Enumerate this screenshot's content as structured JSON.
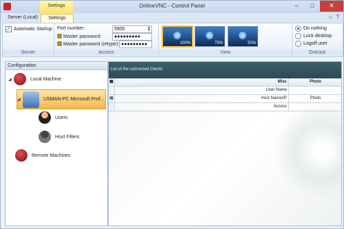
{
  "window": {
    "title": "OnlineVNC - Control Panel",
    "context_tab": "Settings"
  },
  "ribbon_tabs": [
    "Server (Local)",
    "Settings"
  ],
  "server_group": {
    "title": "Server",
    "automatic_startup_label": "Automatic Startup",
    "automatic_startup_checked": true
  },
  "access_group": {
    "title": "Access",
    "port_label": "Port number:",
    "port_value": "5900",
    "master_password_label": "Master password:",
    "master_password_value": "●●●●●●●●●",
    "master_password_retype_label": "Master password (retype):",
    "master_password_retype_value": "●●●●●●●●●"
  },
  "view_group": {
    "title": "View",
    "thumbnails": [
      "100%",
      "75%",
      "50%"
    ],
    "selected": "100%"
  },
  "outcast_group": {
    "title": "Outcast",
    "options": [
      "Do nothing",
      "Lock desktop",
      "Logoff user"
    ],
    "selected": "Do nothing"
  },
  "configuration": {
    "title": "Configuration",
    "local_machine": "Local Machine",
    "pc_item": "USMAN-PC Microsoft Prof...",
    "users": "Users",
    "host_filters": "Host Filters",
    "remote_machines": "Remote Machines"
  },
  "clients": {
    "title": "List of the connected Clients",
    "columns": [
      "Misc",
      "Photo"
    ],
    "rows": [
      "User Name",
      "Host Name/IP",
      "Access"
    ],
    "photo_value": "Photo"
  },
  "colors": {
    "accent": "#f3c23f",
    "header_dark": "#2c4b55",
    "close_button": "#c7403a"
  }
}
